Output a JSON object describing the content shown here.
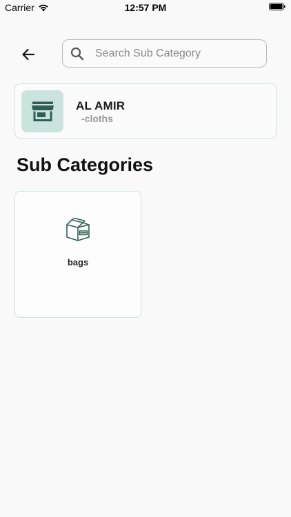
{
  "status_bar": {
    "carrier": "Carrier",
    "time": "12:57 PM",
    "icons": [
      "wifi-icon",
      "battery-icon"
    ]
  },
  "header": {
    "back_icon": "arrow-left-icon",
    "search": {
      "placeholder": "Search Sub Category",
      "value": "",
      "icon": "search-icon"
    }
  },
  "store": {
    "name": "AL AMIR",
    "category": "-cloths",
    "icon": "storefront-icon"
  },
  "section": {
    "title": "Sub Categories"
  },
  "subcategories": [
    {
      "label": "bags",
      "icon": "box-icon"
    }
  ],
  "colors": {
    "accent": "#2f5e55",
    "thumb_bg": "#cbe3dd",
    "card_border": "#cfe3df",
    "background": "#f9f9f9"
  }
}
